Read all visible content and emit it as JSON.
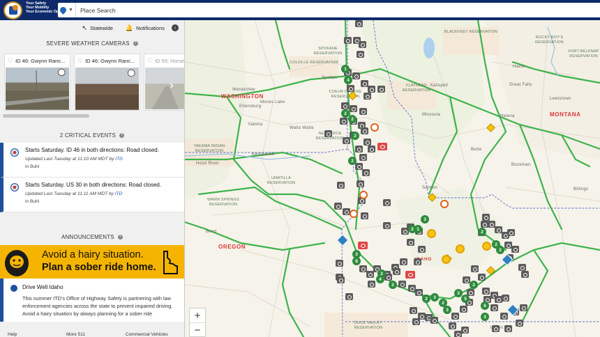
{
  "header": {
    "tagline": [
      "Your Safety",
      "Your Mobility",
      "Your Economic Opportunity"
    ],
    "search_placeholder": "Place Search"
  },
  "quick_links": {
    "statewide": "Statewide",
    "notifications": "Notifications"
  },
  "cameras": {
    "section_title": "SEVERE WEATHER CAMERAS",
    "items": [
      {
        "name": "ID 46: Gwynn Ranc..."
      },
      {
        "name": "ID 46: Gwynn Ranc..."
      },
      {
        "name": "ID 55: Horse"
      }
    ]
  },
  "events": {
    "section_title": "2 CRITICAL EVENTS",
    "items": [
      {
        "title": "Starts Saturday. ID 46 in both directions: Road closed.",
        "updated": "Updated Last Tuesday at 11:10 AM MDT by",
        "source": "ITD",
        "location": "in Buhl"
      },
      {
        "title": "Starts Saturday. US 30 in both directions: Road closed.",
        "updated": "Updated Last Tuesday at 11:11 AM MDT by",
        "source": "ITD",
        "location": "in Buhl"
      }
    ]
  },
  "announcements": {
    "section_title": "ANNOUNCEMENTS",
    "banner_line1": "Avoid a hairy situation.",
    "banner_line2": "Plan a sober ride home.",
    "news_title": "Drive Well Idaho",
    "news_body": "This summer ITD's Office of Highway Safety is partnering with law enforcement agencies across the state to prevent impaired driving. Avoid a hairy situation by always planning for a sober ride"
  },
  "footer": {
    "help": "Help",
    "more": "More 511",
    "commercial": "Commercial Vehicles"
  },
  "map": {
    "states": {
      "washington": "WASHINGTON",
      "oregon": "OREGON",
      "montana": "MONTANA",
      "idaho": "IDAHO"
    },
    "cities": {
      "spokane": "Spokan",
      "wenatchee": "Wenatchee",
      "moses_lake": "Moses Lake",
      "ellensburg": "Ellensburg",
      "yakima": "Yakima",
      "kennewick": "Kennewick",
      "walla_walla": "Walla Walla",
      "hood_river": "Hood River",
      "bend": "Bend",
      "missoula": "Missoula",
      "kalispell": "Kalispell",
      "great_falls": "Great Falls",
      "helena": "Helena",
      "butte": "Butte",
      "bozeman": "Bozeman",
      "billings": "Billings",
      "lewistown": "Lewistown",
      "havre": "Havre",
      "salmon": "Salmon",
      "logan": "Logan"
    },
    "reservations": {
      "colville": "COLVILLE RESERVATION",
      "yakama": "YAKAMA INDIAN RESERVATION",
      "warm_springs": "WARM SPRINGS RESERVATION",
      "umatilla": "UMATILLA RESERVATION",
      "blackfeet": "BLACKFEET RESERVATION",
      "flathead": "FLATHEAD RESERVATION",
      "fort_belknap": "FORT BELKNAP RESERVATION",
      "rocky_boy": "ROCKY BOY'S RESERVATION",
      "duck_valley": "DUCK VALLEY RESERVATION",
      "spokane": "SPOKANE RESERVATION",
      "coeur": "COEUR D'ALENE RESERVATION",
      "nez_perce": "NEZ PERCE RESERVATION"
    },
    "zoom_in": "+",
    "zoom_out": "−",
    "accent": "#0e2a6b",
    "highway_color": "#3db34a",
    "camera_marker_count": 97
  }
}
